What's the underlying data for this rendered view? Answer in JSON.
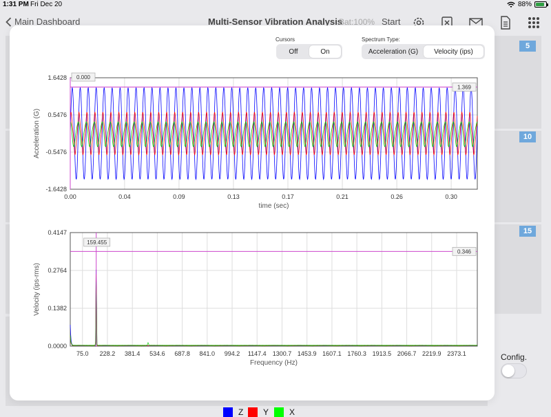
{
  "status_bar": {
    "time": "1:31 PM",
    "date": "Fri Dec 20",
    "battery": "88%",
    "battery_level": 0.88
  },
  "nav": {
    "back_label": "Main Dashboard",
    "title": "Multi-Sensor Vibration Analysis",
    "battery_text": "Bat:100%",
    "start_label": "Start",
    "icons": [
      "gear-icon",
      "close-box-icon",
      "mail-icon",
      "document-icon",
      "grid-icon"
    ]
  },
  "background": {
    "badges": [
      "5",
      "10",
      "15"
    ],
    "config_label": "Config.",
    "config_on": false
  },
  "controls": {
    "cursors_label": "Cursors",
    "cursors_options": [
      "Off",
      "On"
    ],
    "cursors_selected": "On",
    "spectrum_label": "Spectrum Type:",
    "spectrum_options": [
      "Acceleration (G)",
      "Velocity (ips)"
    ],
    "spectrum_selected": "Velocity (ips)"
  },
  "chart_data": [
    {
      "type": "line",
      "xlabel": "time (sec)",
      "ylabel": "Acceleration (G)",
      "xlim": [
        0,
        0.32
      ],
      "ylim": [
        -1.6428,
        1.6428
      ],
      "xticks": [
        "0.00",
        "0.04",
        "0.09",
        "0.13",
        "0.17",
        "0.21",
        "0.26",
        "0.30"
      ],
      "xtick_values": [
        0,
        0.0427,
        0.0855,
        0.1283,
        0.1711,
        0.2139,
        0.2567,
        0.2995
      ],
      "yticks": [
        "1.6428",
        "0.5476",
        "-0.5476",
        "-1.6428"
      ],
      "ytick_values": [
        1.6428,
        0.5476,
        -0.5476,
        -1.6428
      ],
      "series": [
        {
          "name": "Z",
          "color": "#0000ff",
          "amplitude": 1.35,
          "frequency_hz": 159.455
        },
        {
          "name": "Y",
          "color": "#ff0000",
          "amplitude": 0.55,
          "frequency_hz": 159.455
        },
        {
          "name": "X",
          "color": "#00cc00",
          "amplitude": 0.35,
          "frequency_hz": 159.455
        }
      ],
      "cursor": {
        "x_label": "0.000",
        "y_value": 1.369,
        "y_label": "1.369",
        "color": "#cc44cc"
      }
    },
    {
      "type": "line",
      "xlabel": "Frequency (Hz)",
      "ylabel": "Velocity (ips-rms)",
      "xlim": [
        0,
        2500
      ],
      "ylim": [
        0,
        0.4147
      ],
      "xticks": [
        "75.0",
        "228.2",
        "381.4",
        "534.6",
        "687.8",
        "841.0",
        "994.2",
        "1147.4",
        "1300.7",
        "1453.9",
        "1607.1",
        "1760.3",
        "1913.5",
        "2066.7",
        "2219.9",
        "2373.1"
      ],
      "xtick_values": [
        75.0,
        228.2,
        381.4,
        534.6,
        687.8,
        841.0,
        994.2,
        1147.4,
        1300.7,
        1453.9,
        1607.1,
        1760.3,
        1913.5,
        2066.7,
        2219.9,
        2373.1
      ],
      "yticks": [
        "0.4147",
        "0.2764",
        "0.1382",
        "0.0000"
      ],
      "ytick_values": [
        0.4147,
        0.2764,
        0.1382,
        0
      ],
      "series": [
        {
          "name": "Z",
          "color": "#0000ff",
          "peak_hz": 159.455,
          "peak_value": 0.36
        },
        {
          "name": "Y",
          "color": "#ff0000",
          "peak_hz": 159.455,
          "peak_value": 0.34
        },
        {
          "name": "X",
          "color": "#00cc00",
          "peak_hz": 159.455,
          "peak_value": 0.3
        }
      ],
      "cursor": {
        "x_value": 159.455,
        "x_label": "159.455",
        "y_value": 0.346,
        "y_label": "0.346",
        "color": "#cc44cc"
      }
    }
  ],
  "legend": [
    {
      "name": "Z",
      "color": "#0000ff"
    },
    {
      "name": "Y",
      "color": "#ff0000"
    },
    {
      "name": "X",
      "color": "#00ff00"
    }
  ]
}
